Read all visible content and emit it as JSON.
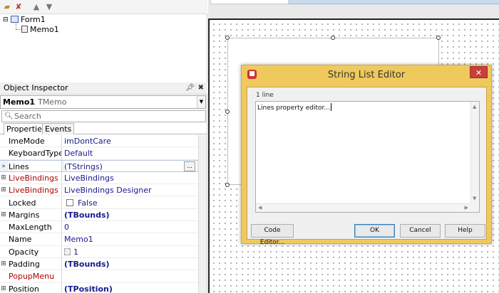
{
  "structure": {
    "tree": [
      {
        "label": "Form1",
        "icon": "form-icon"
      },
      {
        "label": "Memo1",
        "icon": "memo-icon"
      }
    ]
  },
  "object_inspector": {
    "title": "Object Inspector",
    "selected_object": "Memo1",
    "selected_type": "TMemo",
    "search_placeholder": "Search",
    "tabs": [
      "Properties",
      "Events"
    ],
    "properties": [
      {
        "name": "ImeMode",
        "value": "imDontCare",
        "expand": ""
      },
      {
        "name": "KeyboardType",
        "value": "Default",
        "expand": ""
      },
      {
        "name": "Lines",
        "value": "(TStrings)",
        "expand": "»"
      },
      {
        "name": "LiveBindings",
        "value": "LiveBindings",
        "expand": "⊞"
      },
      {
        "name": "LiveBindings Des",
        "value": "LiveBindings Designer",
        "expand": "⊞"
      },
      {
        "name": "Locked",
        "value": "False",
        "expand": ""
      },
      {
        "name": "Margins",
        "value": "(TBounds)",
        "expand": "⊞"
      },
      {
        "name": "MaxLength",
        "value": "0",
        "expand": ""
      },
      {
        "name": "Name",
        "value": "Memo1",
        "expand": ""
      },
      {
        "name": "Opacity",
        "value": "1",
        "expand": ""
      },
      {
        "name": "Padding",
        "value": "(TBounds)",
        "expand": "⊞"
      },
      {
        "name": "PopupMenu",
        "value": "",
        "expand": ""
      },
      {
        "name": "Position",
        "value": "(TPosition)",
        "expand": "⊞"
      }
    ],
    "ellipsis_label": "..."
  },
  "dialog": {
    "title": "String List Editor",
    "line_count": "1 line",
    "text": "Lines property editor...",
    "code_editor_button": "Code Editor...",
    "ok_button": "OK",
    "cancel_button": "Cancel",
    "help_button": "Help",
    "close_glyph": "✕"
  },
  "colors": {
    "dialog_frame": "#f0c95d",
    "close_button": "#c7403a",
    "property_value": "#1a1a8c",
    "event_property": "#b00000"
  }
}
